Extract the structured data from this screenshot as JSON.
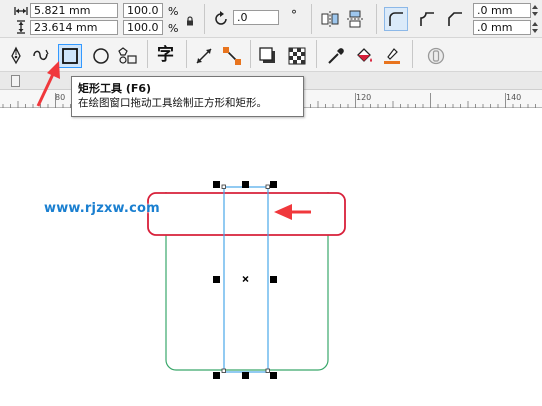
{
  "property_bar": {
    "width_value": "5.821 mm",
    "height_value": "23.614 mm",
    "scale_x": "100.0",
    "scale_y": "100.0",
    "percent_x": "%",
    "percent_y": "%",
    "rotation_value": ".0",
    "degree_symbol": "°",
    "corner_radius_top_left": ".0 mm",
    "corner_radius_bottom_left": ".0 mm"
  },
  "toolbox": {
    "text_tool_glyph": "字"
  },
  "tooltip": {
    "title": "矩形工具 (F6)",
    "description": "在绘图窗口拖动工具绘制正方形和矩形。"
  },
  "ruler": {
    "labels": [
      "80",
      "120",
      "140"
    ]
  },
  "watermark": {
    "text": "www.rjzxw.com"
  },
  "colors": {
    "accent_blue": "#3399ff",
    "callout_red": "#d8203a",
    "arrow_red": "#f0383c",
    "rectangle_green": "#3aa86b",
    "guide_blue": "#4aa8e8",
    "watermark_blue": "#1a7fd0"
  },
  "icons": {
    "width_dimension": "width-dimension-icon",
    "height_dimension": "height-dimension-icon",
    "lock": "lock-icon",
    "rotate": "rotate-icon",
    "mirror_h": "mirror-horizontal-icon",
    "mirror_v": "mirror-vertical-icon",
    "rect_tool": "rectangle-tool-icon"
  }
}
